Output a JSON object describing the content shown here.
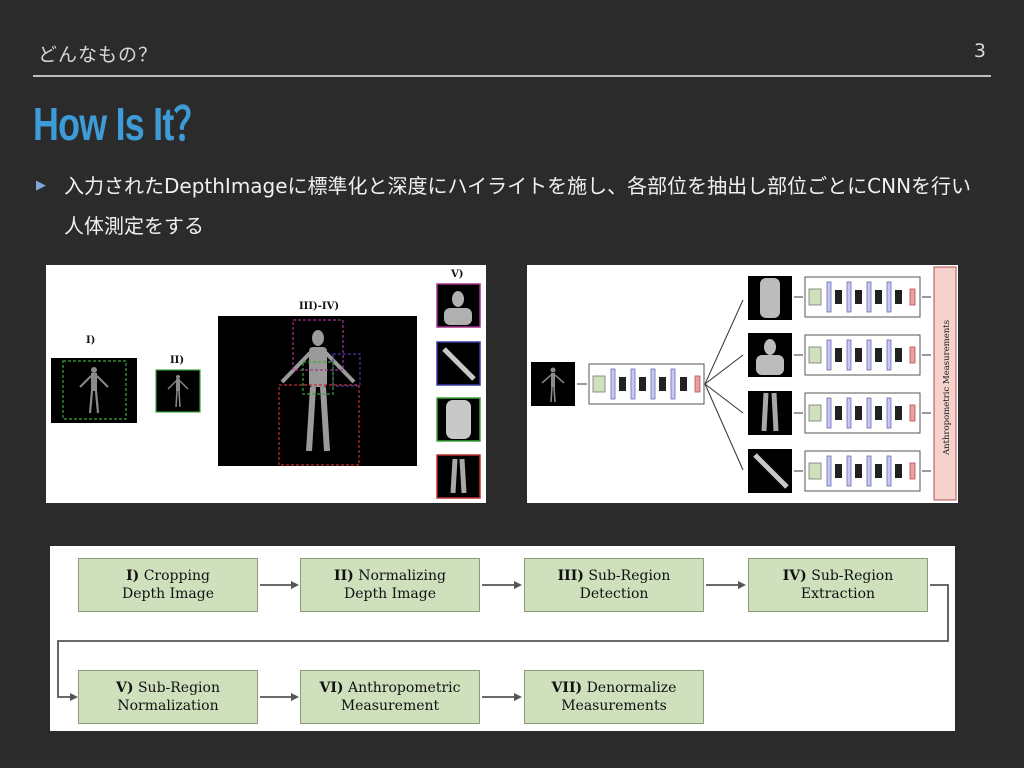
{
  "header": {
    "section_label": "どんなもの？",
    "page_number": "3",
    "title": "How Is It？"
  },
  "bullet": {
    "icon": "triangle-right-icon",
    "text": "入力されたDepthImageに標準化と深度にハイライトを施し、各部位を抽出し部位ごとにCNNを行い人体測定をする"
  },
  "figure_left": {
    "label_i": "I)",
    "label_ii": "II)",
    "label_iii_iv": "III)-IV)",
    "label_v": "V)"
  },
  "figure_right": {
    "side_label": "Anthropometric Measurements"
  },
  "flowchart": {
    "steps": [
      {
        "num": "I)",
        "line1": "Cropping",
        "line2": "Depth Image"
      },
      {
        "num": "II)",
        "line1": "Normalizing",
        "line2": "Depth Image"
      },
      {
        "num": "III)",
        "line1": "Sub-Region",
        "line2": "Detection"
      },
      {
        "num": "IV)",
        "line1": "Sub-Region",
        "line2": "Extraction"
      },
      {
        "num": "V)",
        "line1": "Sub-Region",
        "line2": "Normalization"
      },
      {
        "num": "VI)",
        "line1": "Anthropometric",
        "line2": "Measurement"
      },
      {
        "num": "VII)",
        "line1": "Denormalize",
        "line2": "Measurements"
      }
    ],
    "box_color": "#cfe0bd",
    "border_color": "#8a9b7c"
  },
  "colors": {
    "background": "#2b2b2b",
    "title": "#3d9bd8"
  }
}
